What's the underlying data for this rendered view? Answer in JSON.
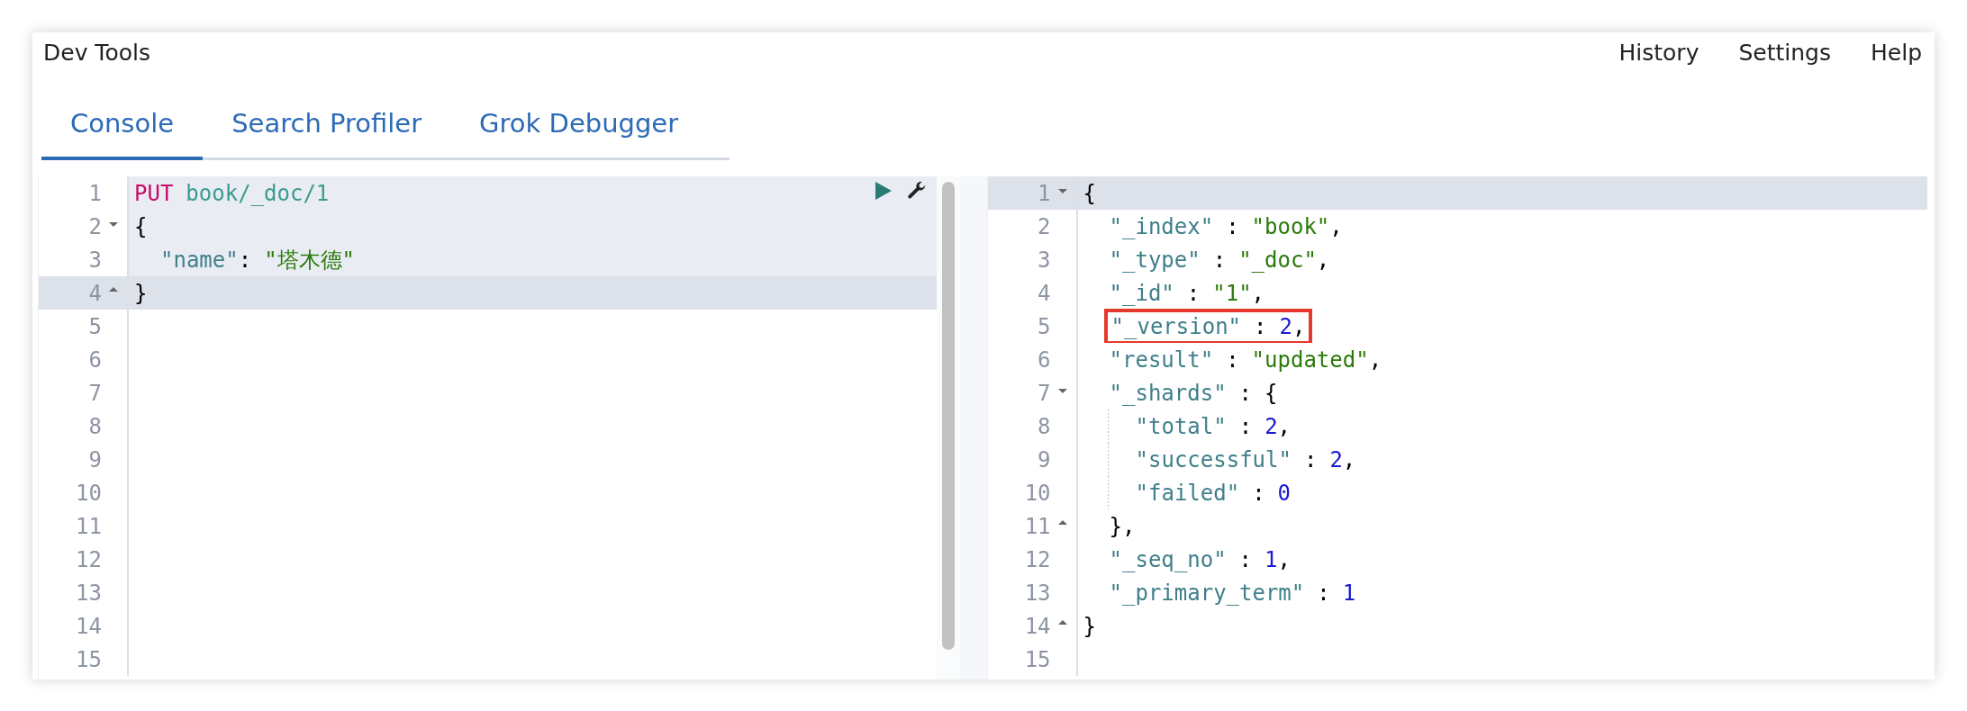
{
  "app_title": "Dev Tools",
  "menu": [
    "History",
    "Settings",
    "Help"
  ],
  "tabs": [
    {
      "label": "Console",
      "selected": true
    },
    {
      "label": "Search Profiler",
      "selected": false
    },
    {
      "label": "Grok Debugger",
      "selected": false
    }
  ],
  "request_editor": {
    "lines": [
      {
        "number": "1",
        "in_request": true,
        "tokens": [
          {
            "kind": "method",
            "text": "PUT"
          },
          {
            "kind": "url",
            "text": "book/_doc/1"
          }
        ]
      },
      {
        "number": "2",
        "in_request": true,
        "tokens": [
          {
            "kind": "punct",
            "text": "{"
          }
        ],
        "children": [
          {
            "number": "3",
            "in_request": true,
            "tokens": [
              {
                "kind": "key",
                "text": "\"name\""
              },
              {
                "kind": "punct",
                "text": ":"
              },
              {
                "kind": "string",
                "text": "\"塔木德\""
              }
            ]
          }
        ]
      },
      {
        "number": "4",
        "current": true,
        "closes": true,
        "tokens": [
          {
            "kind": "punct",
            "text": "}"
          }
        ]
      },
      {
        "number": "5"
      },
      {
        "number": "6"
      },
      {
        "number": "7"
      },
      {
        "number": "8"
      },
      {
        "number": "9"
      },
      {
        "number": "10"
      },
      {
        "number": "11"
      },
      {
        "number": "12"
      },
      {
        "number": "13"
      },
      {
        "number": "14"
      },
      {
        "number": "15"
      }
    ]
  },
  "response_editor": {
    "lines": [
      {
        "number": "1",
        "current": true,
        "tokens": [
          {
            "kind": "punct",
            "text": "{"
          }
        ],
        "children": [
          {
            "number": "2",
            "tokens": [
              {
                "kind": "key",
                "text": "\"_index\""
              },
              {
                "kind": "punct",
                "text": ":"
              },
              {
                "kind": "string",
                "text": "\"book\""
              },
              {
                "kind": "comma",
                "text": ","
              }
            ]
          },
          {
            "number": "3",
            "tokens": [
              {
                "kind": "key",
                "text": "\"_type\""
              },
              {
                "kind": "punct",
                "text": ":"
              },
              {
                "kind": "string",
                "text": "\"_doc\""
              },
              {
                "kind": "comma",
                "text": ","
              }
            ]
          },
          {
            "number": "4",
            "tokens": [
              {
                "kind": "key",
                "text": "\"_id\""
              },
              {
                "kind": "punct",
                "text": ":"
              },
              {
                "kind": "string",
                "text": "\"1\""
              },
              {
                "kind": "comma",
                "text": ","
              }
            ]
          },
          {
            "number": "5",
            "boxed": true,
            "tokens": [
              {
                "kind": "key",
                "text": "\"_version\""
              },
              {
                "kind": "punct",
                "text": ":"
              },
              {
                "kind": "number",
                "text": "2"
              },
              {
                "kind": "comma",
                "text": ","
              }
            ]
          },
          {
            "number": "6",
            "tokens": [
              {
                "kind": "key",
                "text": "\"result\""
              },
              {
                "kind": "punct",
                "text": ":"
              },
              {
                "kind": "string",
                "text": "\"updated\""
              },
              {
                "kind": "comma",
                "text": ","
              }
            ]
          },
          {
            "number": "7",
            "tokens": [
              {
                "kind": "key",
                "text": "\"_shards\""
              },
              {
                "kind": "punct",
                "text": ":"
              },
              {
                "kind": "punct",
                "text": "{"
              }
            ],
            "children": [
              {
                "number": "8",
                "tokens": [
                  {
                    "kind": "key",
                    "text": "\"total\""
                  },
                  {
                    "kind": "punct",
                    "text": ":"
                  },
                  {
                    "kind": "number",
                    "text": "2"
                  },
                  {
                    "kind": "comma",
                    "text": ","
                  }
                ]
              },
              {
                "number": "9",
                "tokens": [
                  {
                    "kind": "key",
                    "text": "\"successful\""
                  },
                  {
                    "kind": "punct",
                    "text": ":"
                  },
                  {
                    "kind": "number",
                    "text": "2"
                  },
                  {
                    "kind": "comma",
                    "text": ","
                  }
                ]
              },
              {
                "number": "10",
                "tokens": [
                  {
                    "kind": "key",
                    "text": "\"failed\""
                  },
                  {
                    "kind": "punct",
                    "text": ":"
                  },
                  {
                    "kind": "number",
                    "text": "0"
                  }
                ]
              }
            ]
          },
          {
            "number": "11",
            "closes": true,
            "tokens": [
              {
                "kind": "punct",
                "text": "},"
              }
            ]
          },
          {
            "number": "12",
            "tokens": [
              {
                "kind": "key",
                "text": "\"_seq_no\""
              },
              {
                "kind": "punct",
                "text": ":"
              },
              {
                "kind": "number",
                "text": "1"
              },
              {
                "kind": "comma",
                "text": ","
              }
            ]
          },
          {
            "number": "13",
            "tokens": [
              {
                "kind": "key",
                "text": "\"_primary_term\""
              },
              {
                "kind": "punct",
                "text": ":"
              },
              {
                "kind": "number",
                "text": "1"
              }
            ]
          }
        ]
      },
      {
        "number": "14",
        "closes": true,
        "tokens": [
          {
            "kind": "punct",
            "text": "}"
          }
        ]
      },
      {
        "number": "15"
      }
    ]
  }
}
